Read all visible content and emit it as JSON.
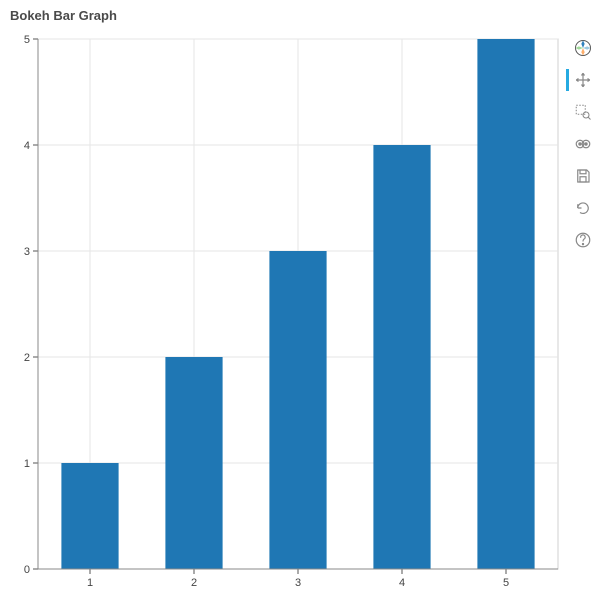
{
  "title": "Bokeh Bar Graph",
  "chart_data": {
    "type": "bar",
    "categories": [
      "1",
      "2",
      "3",
      "4",
      "5"
    ],
    "values": [
      1,
      2,
      3,
      4,
      5
    ],
    "title": "Bokeh Bar Graph",
    "xlabel": "",
    "ylabel": "",
    "ylim": [
      0,
      5
    ],
    "y_ticks": [
      0,
      1,
      2,
      3,
      4,
      5
    ],
    "bar_color": "#1f77b4",
    "grid": true
  },
  "toolbar": {
    "tools": [
      {
        "name": "pan-icon",
        "active": true
      },
      {
        "name": "box-zoom-icon",
        "active": false
      },
      {
        "name": "wheel-zoom-icon",
        "active": false
      },
      {
        "name": "save-icon",
        "active": false
      },
      {
        "name": "reset-icon",
        "active": false
      },
      {
        "name": "help-icon",
        "active": false
      }
    ]
  }
}
